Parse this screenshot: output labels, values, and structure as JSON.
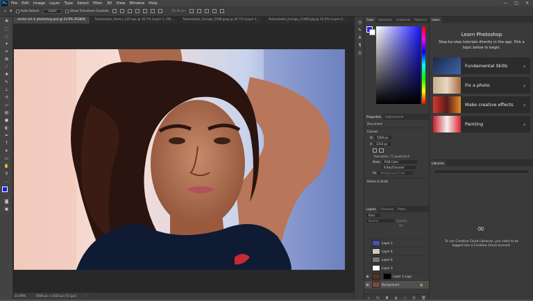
{
  "menubar": {
    "logo": "Ps",
    "items": [
      "File",
      "Edit",
      "Image",
      "Layer",
      "Type",
      "Select",
      "Filter",
      "3D",
      "View",
      "Window",
      "Help"
    ],
    "window_controls": [
      "—",
      "□",
      "✕"
    ]
  },
  "options": {
    "auto_select_label": "Auto-Select:",
    "auto_select_target": "Layer",
    "transform_label": "Show Transform Controls",
    "mode_label": "3D Mode:"
  },
  "doc_tabs": [
    "vector art in photoshop.psd @ 23.9% (RGB/8)",
    "Textunitatio_Vector_125.eps @ 16.7% (Layer 1, CM...",
    "Textunitatio_Grunge_2198.jpeg @ 16.7% (Layer 1...",
    "Textunitatio_Grunge_21400.jpg @ 12.5% (Layer 0..."
  ],
  "status": {
    "zoom": "23.06%",
    "doc_size": "5000 px x 3333 px (72 ppi)"
  },
  "color_panel": {
    "tabs": [
      "Color",
      "Swatches",
      "Gradients",
      "Patterns"
    ]
  },
  "properties_panel": {
    "tabs": [
      "Properties",
      "Adjustments"
    ],
    "section_document": "Document",
    "section_canvas": "Canvas",
    "w": "5000 px",
    "h": "3333 px",
    "resolution": "Resolution: 72 pixels/inch",
    "mode_label": "Mode",
    "mode_value": "RGB Color",
    "depth_value": "8 Bits/Channel",
    "fill_label": "Fill",
    "fill_value": "Background Color",
    "rulers": "Rulers & Grids"
  },
  "layers_panel": {
    "tabs": [
      "Layers",
      "Channels",
      "Paths"
    ],
    "kind": "Kind",
    "blend": "Normal",
    "opacity_label": "Opacity:",
    "fill_label": "Fill:",
    "layers": [
      {
        "name": "Layer 2"
      },
      {
        "name": "Layer 4"
      },
      {
        "name": "Layer 6"
      },
      {
        "name": "Layer 3"
      },
      {
        "name": "Layer 1 copy"
      },
      {
        "name": "Background"
      }
    ]
  },
  "learn_panel": {
    "tab": "Learn",
    "title": "Learn Photoshop",
    "subtitle": "Step-by-step tutorials directly in the app. Pick a topic below to begin.",
    "cards": [
      "Fundamental Skills",
      "Fix a photo",
      "Make creative effects",
      "Painting"
    ]
  },
  "libraries_panel": {
    "tab": "Libraries",
    "message": "To use Creative Cloud Libraries, you need to be logged into a Creative Cloud account."
  },
  "colors": {
    "accent": "#1473e6",
    "panel": "#3a3a3a",
    "canvas": "#282828"
  }
}
